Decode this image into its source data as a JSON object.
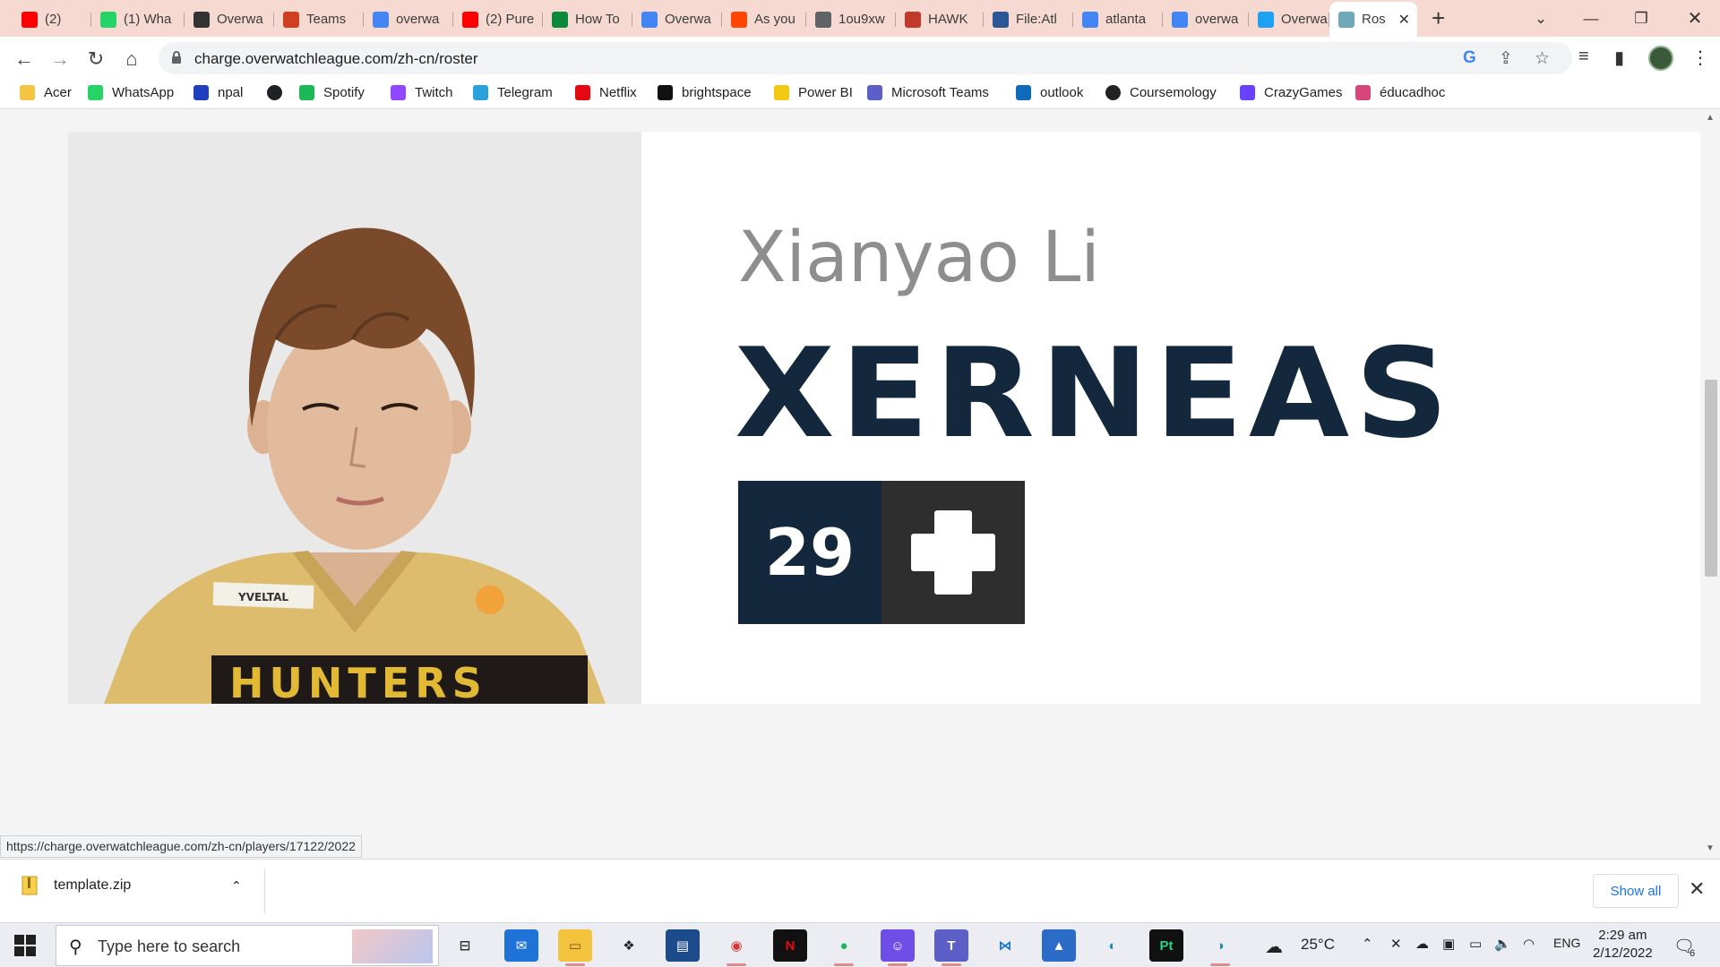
{
  "tabs": [
    {
      "label": "(2)",
      "color": "#ff0000",
      "icon": "youtube-icon"
    },
    {
      "label": "(1) Wha",
      "color": "#25d366",
      "icon": "whatsapp-icon"
    },
    {
      "label": "Overwa",
      "color": "#333333",
      "icon": "overwatch-icon"
    },
    {
      "label": "Teams",
      "color": "#d04020",
      "icon": "teams-flag-icon"
    },
    {
      "label": "overwa",
      "color": "#4285f4",
      "icon": "google-icon"
    },
    {
      "label": "(2) Pure",
      "color": "#ff0000",
      "icon": "youtube-icon"
    },
    {
      "label": "How To",
      "color": "#0a8a3a",
      "icon": "wikihow-icon"
    },
    {
      "label": "Overwa",
      "color": "#4285f4",
      "icon": "google-icon"
    },
    {
      "label": "As you",
      "color": "#ff4500",
      "icon": "reddit-icon"
    },
    {
      "label": "1ou9xw",
      "color": "#5f6368",
      "icon": "globe-icon"
    },
    {
      "label": "HAWK",
      "color": "#c0392b",
      "icon": "hawk-icon"
    },
    {
      "label": "File:Atl",
      "color": "#2b5797",
      "icon": "wiki-file-icon"
    },
    {
      "label": "atlanta",
      "color": "#4285f4",
      "icon": "google-icon"
    },
    {
      "label": "overwa",
      "color": "#4285f4",
      "icon": "google-icon"
    },
    {
      "label": "Overwa",
      "color": "#1da1f2",
      "icon": "twitter-icon"
    },
    {
      "label": "Ros",
      "color": "#6fa8b8",
      "icon": "charge-icon",
      "active": true
    }
  ],
  "toolbar": {
    "url": "charge.overwatchleague.com/zh-cn/roster"
  },
  "bookmarks": [
    {
      "label": "Acer",
      "color": "#f4c542",
      "icon": "folder-icon"
    },
    {
      "label": "WhatsApp",
      "color": "#25d366",
      "icon": "whatsapp-icon"
    },
    {
      "label": "npal",
      "color": "#1f3fbf",
      "icon": "npal-icon"
    },
    {
      "label": "",
      "color": "#202124",
      "icon": "globe-icon"
    },
    {
      "label": "Spotify",
      "color": "#1db954",
      "icon": "spotify-icon"
    },
    {
      "label": "Twitch",
      "color": "#9146ff",
      "icon": "twitch-icon"
    },
    {
      "label": "Telegram",
      "color": "#2aa1da",
      "icon": "telegram-icon"
    },
    {
      "label": "Netflix",
      "color": "#e50914",
      "icon": "netflix-icon"
    },
    {
      "label": "brightspace",
      "color": "#111111",
      "icon": "np-icon"
    },
    {
      "label": "Power BI",
      "color": "#f2c811",
      "icon": "powerbi-icon"
    },
    {
      "label": "Microsoft Teams",
      "color": "#5b5fc7",
      "icon": "teams-icon"
    },
    {
      "label": "outlook",
      "color": "#0f6cbd",
      "icon": "outlook-icon"
    },
    {
      "label": "Coursemology",
      "color": "#222222",
      "icon": "coursemology-icon"
    },
    {
      "label": "CrazyGames",
      "color": "#6842ff",
      "icon": "crazygames-icon"
    },
    {
      "label": "éducadhoc",
      "color": "#d8457a",
      "icon": "educadhoc-icon"
    }
  ],
  "player": {
    "real_name": "Xianyao Li",
    "handle": "XERNEAS",
    "number": "29",
    "role_icon": "support-plus-icon",
    "jersey_name": "YVELTAL",
    "jersey_text": "HUNTERS"
  },
  "status_url": "https://charge.overwatchleague.com/zh-cn/players/17122/2022",
  "downloads": {
    "file_name": "template.zip",
    "show_all": "Show all"
  },
  "taskbar": {
    "search_placeholder": "Type here to search",
    "temperature": "25°C",
    "language": "ENG",
    "time": "2:29 am",
    "date": "2/12/2022",
    "notification_count": "6"
  },
  "colors": {
    "brand_navy": "#13283d",
    "role_dark": "#2e2e2e",
    "jersey_yellow": "#e0c070"
  }
}
